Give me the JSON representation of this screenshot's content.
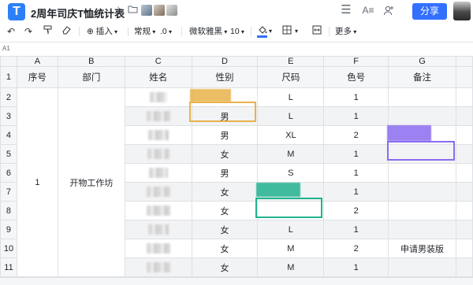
{
  "app": {
    "logo": "T"
  },
  "title": "2周年司庆T恤统计表",
  "header": {
    "share_label": "分享"
  },
  "toolbar": {
    "insert_label": "插入",
    "format_label": "常规",
    "decimal_label": ".0",
    "font_label": "微软雅黑",
    "font_size": "10",
    "more_label": "更多"
  },
  "namebox": "A1",
  "columns": [
    "A",
    "B",
    "C",
    "D",
    "E",
    "F",
    "G"
  ],
  "headers": [
    "序号",
    "部门",
    "姓名",
    "性别",
    "尺码",
    "色号",
    "备注"
  ],
  "merged": {
    "index": "1",
    "dept": "开物工作坊"
  },
  "rows": [
    {
      "num": "2",
      "gender": "",
      "size": "L",
      "color": "1",
      "note": ""
    },
    {
      "num": "3",
      "gender": "男",
      "size": "L",
      "color": "1",
      "note": ""
    },
    {
      "num": "4",
      "gender": "男",
      "size": "XL",
      "color": "2",
      "note": ""
    },
    {
      "num": "5",
      "gender": "女",
      "size": "M",
      "color": "1",
      "note": ""
    },
    {
      "num": "6",
      "gender": "男",
      "size": "S",
      "color": "1",
      "note": ""
    },
    {
      "num": "7",
      "gender": "女",
      "size": "",
      "color": "1",
      "note": ""
    },
    {
      "num": "8",
      "gender": "女",
      "size": "",
      "color": "2",
      "note": ""
    },
    {
      "num": "9",
      "gender": "女",
      "size": "L",
      "color": "1",
      "note": ""
    },
    {
      "num": "10",
      "gender": "女",
      "size": "M",
      "color": "2",
      "note": "申请男装版"
    },
    {
      "num": "11",
      "gender": "女",
      "size": "M",
      "color": "1",
      "note": ""
    }
  ],
  "collaborator_colors": {
    "orange": "#e8b24a",
    "teal": "#21b28f",
    "purple": "#8a6cf0"
  },
  "accent": "#3370ff"
}
